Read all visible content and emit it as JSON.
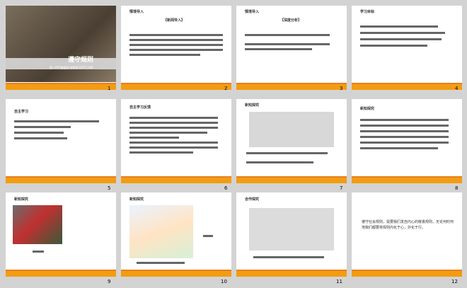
{
  "slides": [
    {
      "num": "1",
      "title": "遵守规则",
      "subtitle": "第一PPT模板网-WWW.1PPT.COM"
    },
    {
      "num": "2",
      "heading": "情境导入",
      "box": "【新闻导入】"
    },
    {
      "num": "3",
      "heading": "情境导入",
      "box": "【深度分析】"
    },
    {
      "num": "4",
      "heading": "学习目标"
    },
    {
      "num": "5",
      "heading": "自主学习"
    },
    {
      "num": "6",
      "heading": "自主学习反馈"
    },
    {
      "num": "7",
      "heading": "新知探究"
    },
    {
      "num": "8",
      "heading": "新知探究"
    },
    {
      "num": "9",
      "heading": "新知探究"
    },
    {
      "num": "10",
      "heading": "新知探究"
    },
    {
      "num": "11",
      "heading": "合作探究"
    },
    {
      "num": "12",
      "body": "遵守社会规则，需要我们发自内心的敬畏规则，无论何时何地我们都要将规则内化于心，外化于行。"
    }
  ]
}
